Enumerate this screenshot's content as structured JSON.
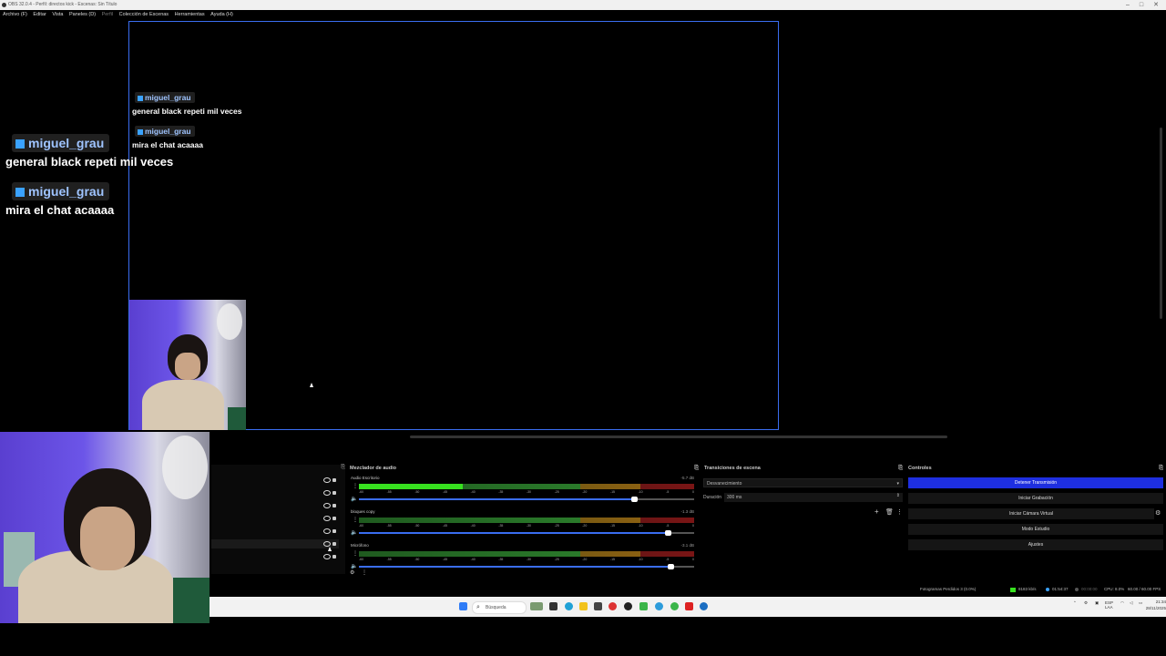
{
  "window": {
    "title": "OBS 32.0.4 - Perfil: directos kick - Escenas: Sin Título",
    "controls": [
      "–",
      "□",
      "✕"
    ]
  },
  "menu": [
    "Archivo (F)",
    "Editar",
    "Vista",
    "Paneles (D)",
    "Perfil",
    "Colección de Escenas",
    "Herramientas",
    "Ayuda (H)"
  ],
  "chat_small": [
    {
      "user": "miguel_grau",
      "message": "general black repeti mil veces"
    },
    {
      "user": "miguel_grau",
      "message": "mira el chat acaaaa"
    }
  ],
  "chat_large": [
    {
      "user": "miguel_grau",
      "message": "general black repeti mil veces"
    },
    {
      "user": "miguel_grau",
      "message": "mira el chat acaaaa"
    }
  ],
  "mixer": {
    "title": "Mezclador de audio",
    "channels": [
      {
        "name": "Audio Escritorio",
        "db": "-5.7 dB",
        "level": 0.31,
        "volume": 0.82
      },
      {
        "name": "bloques copy",
        "db": "-1.3 dB",
        "level": 0.0,
        "volume": 0.92
      },
      {
        "name": "Micrófono",
        "db": "-3.1 dB",
        "level": 0.0,
        "volume": 0.93
      }
    ],
    "ticks": [
      "-60",
      "-55",
      "-50",
      "-45",
      "-40",
      "-35",
      "-30",
      "-25",
      "-20",
      "-15",
      "-10",
      "-5",
      "0"
    ]
  },
  "transitions": {
    "title": "Transiciones de escena",
    "selected": "Desvanecimiento",
    "duration_label": "Duración",
    "duration_value": "300 ms"
  },
  "controls": {
    "title": "Controles",
    "buttons": [
      "Detener Transmisión",
      "Iniciar Grabación",
      "Iniciar Cámara Virtual",
      "Modo Estudio",
      "Ajustes"
    ]
  },
  "status": {
    "dropped": "Fotogramas Perdidos 3 (0.0%)",
    "bitrate": "8183 kb/s",
    "stream_time": "01:54:37",
    "rec_time": "00:00:00",
    "cpu": "CPU: 8.0%",
    "fps": "60.00 / 60.00 FPS"
  },
  "taskbar": {
    "search_placeholder": "Búsqueda",
    "lang": "ESP LAA",
    "time": "21:34",
    "date": "28/11/2025"
  },
  "colors": {
    "accent": "#3a6df0",
    "primary_button": "#1e2fe0",
    "meter_green": "#37e11f"
  }
}
